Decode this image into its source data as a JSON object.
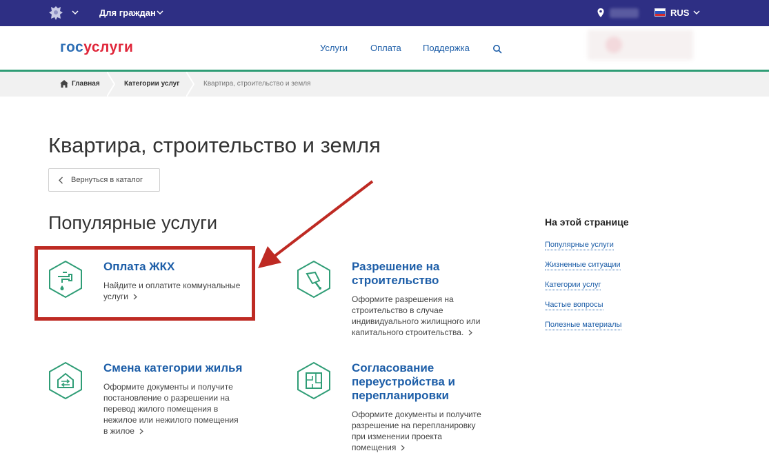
{
  "topbar": {
    "section_label": "Для граждан",
    "language": "RUS",
    "flag_colors": [
      "#ffffff",
      "#2a57c2",
      "#d82b2b"
    ]
  },
  "header": {
    "logo_part1": "гос",
    "logo_part2": "услуги",
    "nav": [
      "Услуги",
      "Оплата",
      "Поддержка"
    ]
  },
  "breadcrumb": {
    "items": [
      "Главная",
      "Категории услуг",
      "Квартира, строительство и земля"
    ]
  },
  "page": {
    "title": "Квартира, строительство и земля",
    "back_label": "Вернуться в каталог",
    "section_title": "Популярные услуги"
  },
  "cards": [
    {
      "title": [
        "Оплата ЖКХ"
      ],
      "desc": [
        "Найдите и оплатите коммунальные",
        "услуги"
      ],
      "icon": "water-tap-icon"
    },
    {
      "title": [
        "Разрешение на",
        "строительство"
      ],
      "desc": [
        "Оформите разрешения на",
        "строительство в случае",
        "индивидуального жилищного или",
        "капитального строительства."
      ],
      "icon": "trowel-icon"
    },
    {
      "title": [
        "Смена категории жилья"
      ],
      "desc": [
        "Оформите документы и получите",
        "постановление о разрешении на",
        "перевод жилого помещения в",
        "нежилое или нежилого помещения",
        "в жилое"
      ],
      "icon": "house-exchange-icon"
    },
    {
      "title": [
        "Согласование",
        "переустройства и",
        "перепланировки"
      ],
      "desc": [
        "Оформите документы и получите",
        "разрешение на перепланировку",
        "при изменении проекта",
        "помещения"
      ],
      "icon": "floor-plan-icon"
    }
  ],
  "sidebar": {
    "title": "На этой странице",
    "links": [
      "Популярные услуги",
      "Жизненные ситуации",
      "Категории услуг",
      "Частые вопросы",
      "Полезные материалы"
    ]
  },
  "colors": {
    "topbar": "#2e2f84",
    "accent_green": "#2f9d76",
    "link_blue": "#1d5ea8",
    "highlight_red": "#be2a23"
  }
}
